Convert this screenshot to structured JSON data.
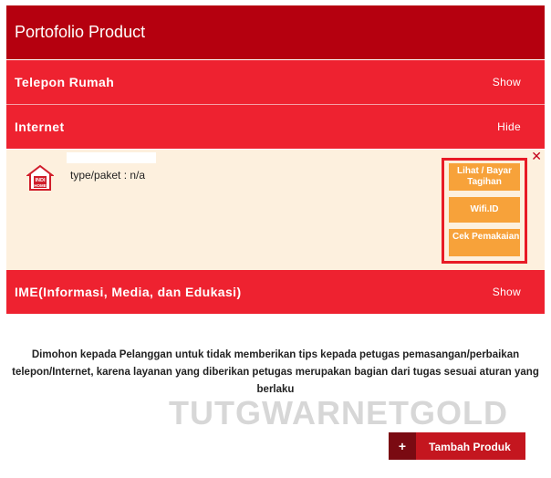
{
  "header": {
    "title": "Portofolio Product"
  },
  "sections": [
    {
      "label": "Telepon Rumah",
      "toggle": "Show"
    },
    {
      "label": "Internet",
      "toggle": "Hide"
    },
    {
      "label": "IME(Informasi, Media, dan Edukasi)",
      "toggle": "Show"
    }
  ],
  "internet_panel": {
    "type_text": "type/paket : n/a",
    "logo_text": [
      "INDI",
      "HOME"
    ],
    "close": "✕",
    "buttons": [
      "Lihat / Bayar Tagihan",
      "Wifi.ID",
      "Cek Pemakaian"
    ]
  },
  "notice": "Dimohon kepada Pelanggan untuk tidak memberikan tips kepada petugas pemasangan/perbaikan telepon/Internet, karena layanan yang diberikan petugas merupakan bagian dari tugas sesuai aturan yang berlaku",
  "watermark": "TUTGWARNETGOLD",
  "add_button": {
    "icon": "+",
    "label": "Tambah Produk"
  },
  "colors": {
    "header": "#b5000f",
    "row": "#ee2230",
    "panel": "#fdf0de",
    "action": "#f7a23a"
  }
}
